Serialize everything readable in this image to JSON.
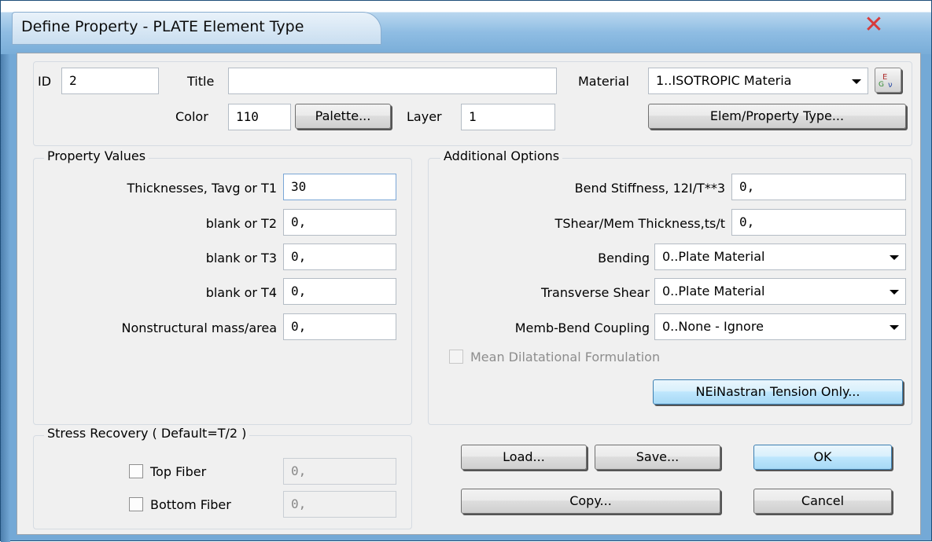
{
  "window": {
    "title": "Define Property - PLATE Element Type"
  },
  "top": {
    "id_label": "ID",
    "id_value": "2",
    "title_label": "Title",
    "title_value": "",
    "material_label": "Material",
    "material_value": "1..ISOTROPIC Materia",
    "color_label": "Color",
    "color_value": "110",
    "palette_button": "Palette...",
    "layer_label": "Layer",
    "layer_value": "1",
    "elem_property_button": "Elem/Property Type..."
  },
  "property_values": {
    "group_title": "Property Values",
    "fields": [
      {
        "label": "Thicknesses, Tavg or T1",
        "value": "30"
      },
      {
        "label": "blank or T2",
        "value": "0,"
      },
      {
        "label": "blank or T3",
        "value": "0,"
      },
      {
        "label": "blank or T4",
        "value": "0,"
      },
      {
        "label": "Nonstructural mass/area",
        "value": "0,"
      }
    ]
  },
  "additional_options": {
    "group_title": "Additional Options",
    "bend_stiffness_label": "Bend Stiffness,  12I/T**3",
    "bend_stiffness_value": "0,",
    "tshear_label": "TShear/Mem Thickness,ts/t",
    "tshear_value": "0,",
    "bending_label": "Bending",
    "bending_value": "0..Plate Material",
    "transverse_label": "Transverse Shear",
    "transverse_value": "0..Plate Material",
    "coupling_label": "Memb-Bend Coupling",
    "coupling_value": "0..None - Ignore",
    "mean_dilatational_label": "Mean Dilatational Formulation",
    "tension_button": "NEiNastran Tension Only..."
  },
  "stress_recovery": {
    "group_title": "Stress Recovery ( Default=T/2 )",
    "top_fiber_label": "Top Fiber",
    "top_fiber_value": "0,",
    "bottom_fiber_label": "Bottom Fiber",
    "bottom_fiber_value": "0,"
  },
  "buttons": {
    "load": "Load...",
    "save": "Save...",
    "ok": "OK",
    "copy": "Copy...",
    "cancel": "Cancel"
  },
  "colors": {
    "title_bar": "#79add8",
    "dialog_background": "#f0f0f0",
    "close_icon": "#d63b3b"
  }
}
